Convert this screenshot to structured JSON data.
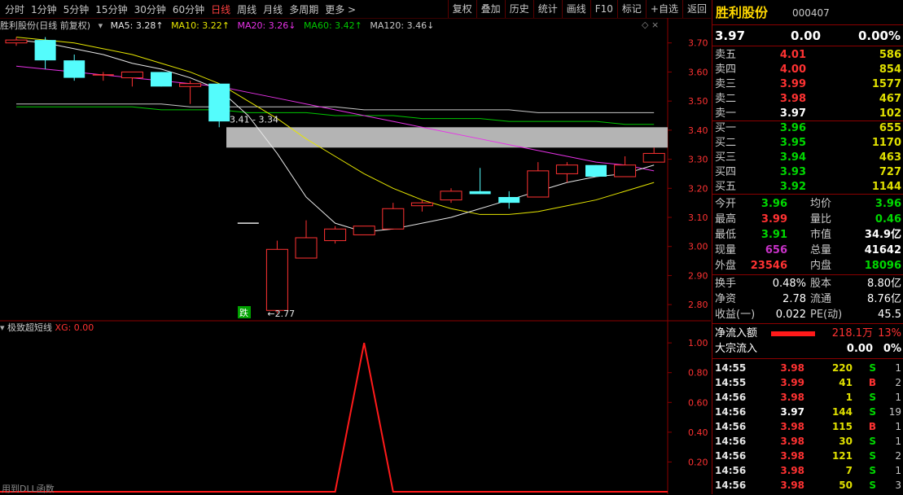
{
  "toolbar": {
    "periods": [
      "分时",
      "1分钟",
      "5分钟",
      "15分钟",
      "30分钟",
      "60分钟",
      "日线",
      "周线",
      "月线",
      "多周期",
      "更多 >"
    ],
    "active_period": "日线",
    "tools": [
      "复权",
      "叠加",
      "历史",
      "统计",
      "画线",
      "F10",
      "标记",
      "+自选",
      "返回"
    ]
  },
  "ma_legend": {
    "title": "胜利股份(日线 前复权)",
    "ma5": "MA5: 3.28↑",
    "ma10": "MA10: 3.22↑",
    "ma20": "MA20: 3.26↓",
    "ma60": "MA60: 3.42↑",
    "ma120": "MA120: 3.46↓"
  },
  "colors": {
    "ma5": "#e6e6e6",
    "ma10": "#e6e600",
    "ma20": "#e632e6",
    "ma60": "#00c800",
    "ma120": "#c8c8c8",
    "up": "#ff3232",
    "down": "#54fcfc",
    "accent": "#ff3232"
  },
  "main_axis": {
    "ticks": [
      "3.70",
      "3.60",
      "3.50",
      "3.40",
      "3.30",
      "3.20",
      "3.10",
      "3.00",
      "2.90",
      "2.80"
    ]
  },
  "annotations": {
    "gap_label": "3.41 - 3.34",
    "low_label": "←2.77",
    "fall_tag": "跌"
  },
  "chart_data": {
    "type": "candlestick",
    "candles": [
      {
        "o": 3.7,
        "h": 3.72,
        "l": 3.69,
        "c": 3.71
      },
      {
        "o": 3.71,
        "h": 3.72,
        "l": 3.61,
        "c": 3.64
      },
      {
        "o": 3.64,
        "h": 3.66,
        "l": 3.57,
        "c": 3.58
      },
      {
        "o": 3.59,
        "h": 3.6,
        "l": 3.57,
        "c": 3.59
      },
      {
        "o": 3.58,
        "h": 3.6,
        "l": 3.55,
        "c": 3.6
      },
      {
        "o": 3.6,
        "h": 3.6,
        "l": 3.55,
        "c": 3.55
      },
      {
        "o": 3.55,
        "h": 3.57,
        "l": 3.49,
        "c": 3.56
      },
      {
        "o": 3.56,
        "h": 3.56,
        "l": 3.41,
        "c": 3.43
      },
      {
        "o": 3.08,
        "h": 3.08,
        "l": 3.08,
        "c": 3.08
      },
      {
        "o": 2.78,
        "h": 3.02,
        "l": 2.77,
        "c": 2.99
      },
      {
        "o": 2.96,
        "h": 3.09,
        "l": 2.96,
        "c": 3.03
      },
      {
        "o": 3.02,
        "h": 3.07,
        "l": 3.01,
        "c": 3.06
      },
      {
        "o": 3.04,
        "h": 3.07,
        "l": 3.04,
        "c": 3.07
      },
      {
        "o": 3.06,
        "h": 3.15,
        "l": 3.06,
        "c": 3.13
      },
      {
        "o": 3.14,
        "h": 3.16,
        "l": 3.12,
        "c": 3.15
      },
      {
        "o": 3.16,
        "h": 3.2,
        "l": 3.15,
        "c": 3.19
      },
      {
        "o": 3.19,
        "h": 3.27,
        "l": 3.18,
        "c": 3.18
      },
      {
        "o": 3.17,
        "h": 3.19,
        "l": 3.13,
        "c": 3.15
      },
      {
        "o": 3.17,
        "h": 3.29,
        "l": 3.17,
        "c": 3.26
      },
      {
        "o": 3.25,
        "h": 3.29,
        "l": 3.22,
        "c": 3.28
      },
      {
        "o": 3.28,
        "h": 3.28,
        "l": 3.24,
        "c": 3.24
      },
      {
        "o": 3.24,
        "h": 3.31,
        "l": 3.24,
        "c": 3.28
      },
      {
        "o": 3.29,
        "h": 3.34,
        "l": 3.29,
        "c": 3.32
      }
    ],
    "ylim": [
      2.75,
      3.73
    ],
    "gap_band": [
      3.34,
      3.41
    ],
    "ma5": [
      3.71,
      3.7,
      3.68,
      3.66,
      3.63,
      3.61,
      3.58,
      3.54,
      3.45,
      3.32,
      3.17,
      3.08,
      3.05,
      3.06,
      3.08,
      3.1,
      3.13,
      3.16,
      3.19,
      3.22,
      3.24,
      3.25,
      3.28
    ],
    "ma10": [
      3.72,
      3.71,
      3.7,
      3.68,
      3.66,
      3.63,
      3.6,
      3.56,
      3.5,
      3.44,
      3.37,
      3.31,
      3.25,
      3.2,
      3.16,
      3.13,
      3.11,
      3.11,
      3.12,
      3.14,
      3.16,
      3.19,
      3.22
    ],
    "ma20": [
      3.62,
      3.61,
      3.6,
      3.59,
      3.58,
      3.57,
      3.56,
      3.55,
      3.53,
      3.51,
      3.49,
      3.47,
      3.45,
      3.43,
      3.41,
      3.39,
      3.37,
      3.35,
      3.33,
      3.31,
      3.29,
      3.28,
      3.26
    ],
    "ma60": [
      3.48,
      3.48,
      3.48,
      3.48,
      3.48,
      3.47,
      3.47,
      3.47,
      3.46,
      3.46,
      3.46,
      3.45,
      3.45,
      3.45,
      3.44,
      3.44,
      3.44,
      3.43,
      3.43,
      3.43,
      3.43,
      3.42,
      3.42
    ],
    "ma120": [
      3.49,
      3.49,
      3.49,
      3.49,
      3.49,
      3.49,
      3.48,
      3.48,
      3.48,
      3.48,
      3.48,
      3.48,
      3.47,
      3.47,
      3.47,
      3.47,
      3.47,
      3.47,
      3.46,
      3.46,
      3.46,
      3.46,
      3.46
    ]
  },
  "sub_chart": {
    "title": "极致超短线",
    "xg_label": "XG: 0.00",
    "ticks": [
      "1.00",
      "0.80",
      "0.60",
      "0.40",
      "0.20"
    ],
    "xg_values": [
      0,
      0,
      0,
      0,
      0,
      0,
      0,
      0,
      0,
      0,
      0,
      0,
      1,
      0,
      0,
      0,
      0,
      0,
      0,
      0,
      0,
      0,
      0
    ],
    "ylim": [
      0,
      1.05
    ],
    "footer": "用到DLL函数"
  },
  "quote": {
    "name": "胜利股份",
    "code": "000407",
    "price": "3.97",
    "change": "0.00",
    "change_pct": "0.00%"
  },
  "order_book": [
    {
      "label": "卖五",
      "price": "4.01",
      "vol": "586",
      "pc": "red"
    },
    {
      "label": "卖四",
      "price": "4.00",
      "vol": "854",
      "pc": "red"
    },
    {
      "label": "卖三",
      "price": "3.99",
      "vol": "1577",
      "pc": "red"
    },
    {
      "label": "卖二",
      "price": "3.98",
      "vol": "467",
      "pc": "red"
    },
    {
      "label": "卖一",
      "price": "3.97",
      "vol": "102",
      "pc": "white"
    },
    {
      "label": "买一",
      "price": "3.96",
      "vol": "655",
      "pc": "green"
    },
    {
      "label": "买二",
      "price": "3.95",
      "vol": "1170",
      "pc": "green"
    },
    {
      "label": "买三",
      "price": "3.94",
      "vol": "463",
      "pc": "green"
    },
    {
      "label": "买四",
      "price": "3.93",
      "vol": "727",
      "pc": "green"
    },
    {
      "label": "买五",
      "price": "3.92",
      "vol": "1144",
      "pc": "green"
    }
  ],
  "stats": [
    {
      "l1": "今开",
      "v1": "3.96",
      "c1": "green",
      "l2": "均价",
      "v2": "3.96",
      "c2": "green"
    },
    {
      "l1": "最高",
      "v1": "3.99",
      "c1": "red",
      "l2": "量比",
      "v2": "0.46",
      "c2": "green"
    },
    {
      "l1": "最低",
      "v1": "3.91",
      "c1": "green",
      "l2": "市值",
      "v2": "34.9亿",
      "c2": "white"
    },
    {
      "l1": "现量",
      "v1": "656",
      "c1": "purple",
      "l2": "总量",
      "v2": "41642",
      "c2": "white"
    },
    {
      "l1": "外盘",
      "v1": "23546",
      "c1": "red",
      "l2": "内盘",
      "v2": "18096",
      "c2": "green"
    }
  ],
  "fundamentals": [
    {
      "l1": "换手",
      "v1": "0.48%",
      "l2": "股本",
      "v2": "8.80亿"
    },
    {
      "l1": "净资",
      "v1": "2.78",
      "l2": "流通",
      "v2": "8.76亿"
    },
    {
      "l1": "收益(一)",
      "v1": "0.022",
      "l2": "PE(动)",
      "v2": "45.5"
    }
  ],
  "flow": {
    "net_label": "净流入额",
    "net_value": "218.1万",
    "net_pct": "13%",
    "block_label": "大宗流入",
    "block_value": "0.00",
    "block_pct": "0%"
  },
  "ticks": [
    {
      "t": "14:55",
      "p": "3.98",
      "pc": "red",
      "v": "220",
      "s": "S",
      "n": "1"
    },
    {
      "t": "14:55",
      "p": "3.99",
      "pc": "red",
      "v": "41",
      "s": "B",
      "n": "2"
    },
    {
      "t": "14:56",
      "p": "3.98",
      "pc": "red",
      "v": "1",
      "s": "S",
      "n": "1"
    },
    {
      "t": "14:56",
      "p": "3.97",
      "pc": "white",
      "v": "144",
      "s": "S",
      "n": "19"
    },
    {
      "t": "14:56",
      "p": "3.98",
      "pc": "red",
      "v": "115",
      "s": "B",
      "n": "1"
    },
    {
      "t": "14:56",
      "p": "3.98",
      "pc": "red",
      "v": "30",
      "s": "S",
      "n": "1"
    },
    {
      "t": "14:56",
      "p": "3.98",
      "pc": "red",
      "v": "121",
      "s": "S",
      "n": "2"
    },
    {
      "t": "14:56",
      "p": "3.98",
      "pc": "red",
      "v": "7",
      "s": "S",
      "n": "1"
    },
    {
      "t": "14:56",
      "p": "3.98",
      "pc": "red",
      "v": "50",
      "s": "S",
      "n": "3"
    }
  ]
}
